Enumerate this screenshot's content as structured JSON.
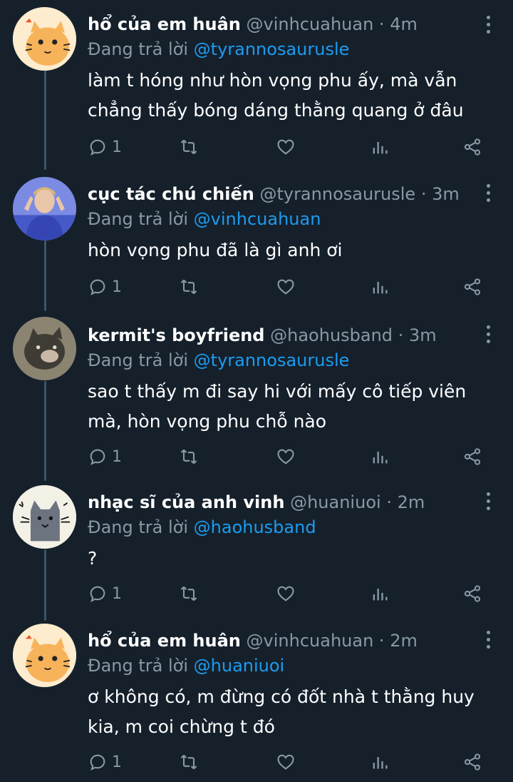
{
  "tweets": [
    {
      "name": "hổ của em huân",
      "handle": "@vinhcuahuan",
      "dot": "·",
      "time": "4m",
      "reply_prefix": "Đang trả lời",
      "reply_to": "@tyrannosaurusle",
      "text": "làm t hóng như hòn vọng phu ấy, mà vẫn chẳng thấy bóng dáng thằng quang ở đâu",
      "reply_count": "1"
    },
    {
      "name": "cục tác chú chiến",
      "handle": "@tyrannosaurusle",
      "dot": "·",
      "time": "3m",
      "reply_prefix": "Đang trả lời",
      "reply_to": "@vinhcuahuan",
      "text": "hòn vọng phu đã là gì anh ơi",
      "reply_count": "1"
    },
    {
      "name": "kermit's boyfriend",
      "handle": "@haohusband",
      "dot": "·",
      "time": "3m",
      "reply_prefix": "Đang trả lời",
      "reply_to": "@tyrannosaurusle",
      "text": "sao t thấy m đi say hi với mấy cô tiếp viên mà, hòn vọng phu chỗ nào",
      "reply_count": "1"
    },
    {
      "name": "nhạc sĩ của anh vinh",
      "handle": "@huaniuoi",
      "dot": "·",
      "time": "2m",
      "reply_prefix": "Đang trả lời",
      "reply_to": "@haohusband",
      "text": "?",
      "reply_count": "1"
    },
    {
      "name": "hổ của em huân",
      "handle": "@vinhcuahuan",
      "dot": "·",
      "time": "2m",
      "reply_prefix": "Đang trả lời",
      "reply_to": "@huaniuoi",
      "text": "ơ không có, m đừng có đốt nhà t thằng huy kia, m coi chừng t đó",
      "reply_count": "1"
    }
  ],
  "icons": {
    "reply": "reply-icon",
    "retweet": "retweet-icon",
    "like": "heart-icon",
    "analytics": "analytics-icon",
    "share": "share-icon",
    "more": "more-vertical-icon"
  },
  "colors": {
    "background": "#15202b",
    "muted": "#8899a6",
    "link": "#1d9bf0",
    "thread_line": "#3d5466"
  }
}
